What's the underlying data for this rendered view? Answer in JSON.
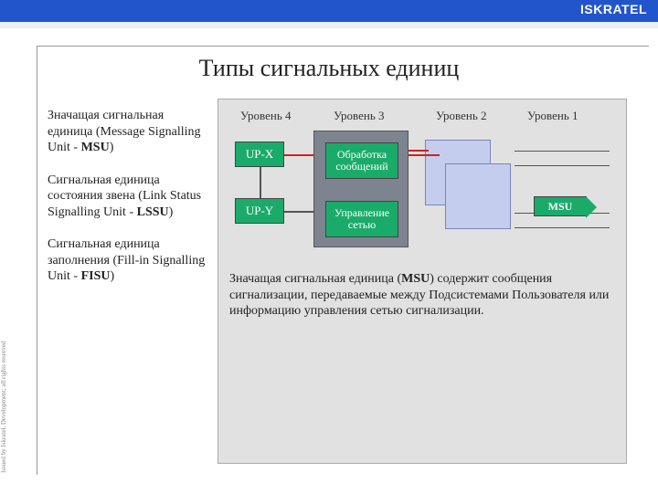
{
  "brand": "ISKRATEL",
  "side_notice": "Issued by Iskratel, Development; all rights reserved",
  "title": "Типы сигнальных единиц",
  "left": {
    "p1a": "Значащая сигнальная единица (Message Signalling Unit - ",
    "p1b": "MSU",
    "p1c": ")",
    "p2a": "Сигнальная единица состояния звена (Link Status Signalling Unit - ",
    "p2b": "LSSU",
    "p2c": ")",
    "p3a": "Сигнальная единица заполнения (Fill-in Signalling Unit - ",
    "p3b": "FISU",
    "p3c": ")"
  },
  "levels": {
    "l4": "Уровень 4",
    "l3": "Уровень 3",
    "l2": "Уровень 2",
    "l1": "Уровень 1"
  },
  "boxes": {
    "upx": "UP-X",
    "upy": "UP-Y",
    "proc": "Обработка сообщений",
    "mgmt": "Управление сетью",
    "msu": "MSU"
  },
  "desc_a": "Значащая сигнальная единица (",
  "desc_b": "MSU",
  "desc_c": ") содержит сообщения сигнализации, передаваемые между Подсистемами Пользователя или информацию управления сетью сигнализации."
}
